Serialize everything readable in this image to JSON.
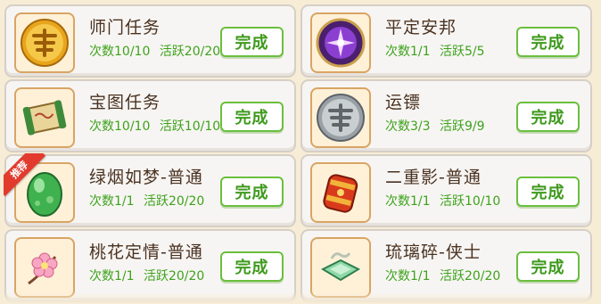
{
  "tasks": [
    {
      "name": "师门任务",
      "count_label": "次数10/10",
      "active_label": "活跃20/20",
      "button": "完成",
      "icon": "dream-coin-icon"
    },
    {
      "name": "平定安邦",
      "count_label": "次数1/1",
      "active_label": "活跃5/5",
      "button": "完成",
      "icon": "purple-orb-icon"
    },
    {
      "name": "宝图任务",
      "count_label": "次数10/10",
      "active_label": "活跃10/10",
      "button": "完成",
      "icon": "treasure-map-icon"
    },
    {
      "name": "运镖",
      "count_label": "次数3/3",
      "active_label": "活跃9/9",
      "button": "完成",
      "icon": "silver-coin-icon"
    },
    {
      "name": "绿烟如梦-普通",
      "count_label": "次数1/1",
      "active_label": "活跃20/20",
      "button": "完成",
      "icon": "green-egg-icon",
      "badge": "推荐"
    },
    {
      "name": "二重影-普通",
      "count_label": "次数1/1",
      "active_label": "活跃10/10",
      "button": "完成",
      "icon": "red-lantern-icon"
    },
    {
      "name": "桃花定情-普通",
      "count_label": "次数1/1",
      "active_label": "活跃20/20",
      "button": "完成",
      "icon": "peach-blossom-icon"
    },
    {
      "name": "琉璃碎-侠士",
      "count_label": "次数1/1",
      "active_label": "活跃20/20",
      "button": "完成",
      "icon": "jade-shard-icon"
    }
  ],
  "colors": {
    "accent_green": "#3ea21c",
    "button_border": "#6abf3d",
    "badge_red": "#e23b2e"
  }
}
